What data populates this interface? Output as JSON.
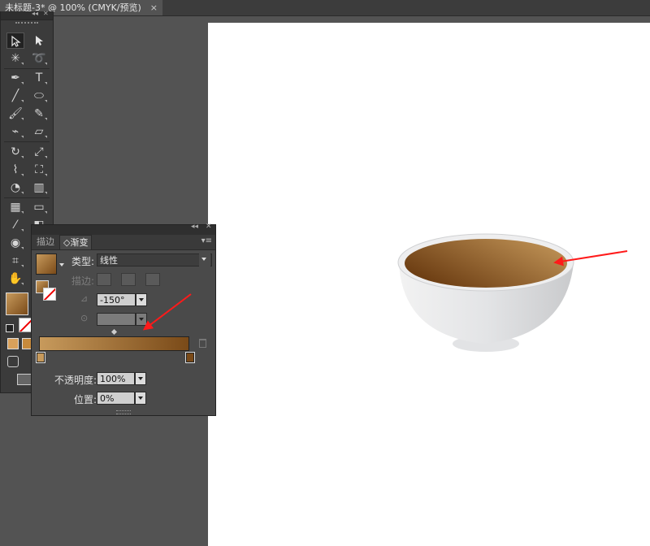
{
  "document_tab": {
    "title": "未标题-3* @ 100% (CMYK/预览)",
    "close": "×"
  },
  "toolbar": {
    "collapse": "◂◂",
    "close": "✕",
    "tools": [
      {
        "name": "selection-tool",
        "glyph": "➤"
      },
      {
        "name": "direct-selection-tool",
        "glyph": "➤"
      },
      {
        "name": "magic-wand-tool",
        "glyph": "✳"
      },
      {
        "name": "lasso-tool",
        "glyph": "⟲"
      },
      {
        "name": "pen-tool",
        "glyph": "✒"
      },
      {
        "name": "type-tool",
        "glyph": "T"
      },
      {
        "name": "line-tool",
        "glyph": "╱"
      },
      {
        "name": "ellipse-tool",
        "glyph": "⬭"
      },
      {
        "name": "paintbrush-tool",
        "glyph": "🖌"
      },
      {
        "name": "pencil-tool",
        "glyph": "✎"
      },
      {
        "name": "blob-brush-tool",
        "glyph": "⌁"
      },
      {
        "name": "eraser-tool",
        "glyph": "▱"
      },
      {
        "name": "rotate-tool",
        "glyph": "↻"
      },
      {
        "name": "scale-tool",
        "glyph": "⤢"
      },
      {
        "name": "warp-tool",
        "glyph": "⌇"
      },
      {
        "name": "free-transform-tool",
        "glyph": "⛶"
      },
      {
        "name": "shape-builder-tool",
        "glyph": "◔"
      },
      {
        "name": "graph-tool",
        "glyph": "▥"
      },
      {
        "name": "mesh-tool",
        "glyph": "▦"
      },
      {
        "name": "gradient-tool",
        "glyph": "▭"
      },
      {
        "name": "eyedropper-tool",
        "glyph": "⁄"
      },
      {
        "name": "blend-tool",
        "glyph": "◧"
      },
      {
        "name": "symbol-sprayer-tool",
        "glyph": "◉"
      },
      {
        "name": "artboard-tool",
        "glyph": "⌗"
      },
      {
        "name": "hand-tool",
        "glyph": "✋"
      }
    ]
  },
  "gradient_panel": {
    "collapse": "◂◂",
    "close": "✕",
    "menu": "▾≡",
    "tab_stroke": "描边",
    "tab_gradient": "◇渐变",
    "type_label": "类型:",
    "type_value": "线性",
    "stroke_label": "描边:",
    "angle_value": "-150°",
    "aspect_value": "",
    "opacity_label": "不透明度:",
    "opacity_value": "100%",
    "location_label": "位置:",
    "location_value": "0%",
    "colors": {
      "start": "#c79a5c",
      "end": "#7a4a18"
    }
  },
  "bowl": {
    "fill_light": "#c49358",
    "fill_dark": "#6e3f14",
    "body": "#e6e7e8"
  },
  "arrow_color": "#ff1a1a"
}
